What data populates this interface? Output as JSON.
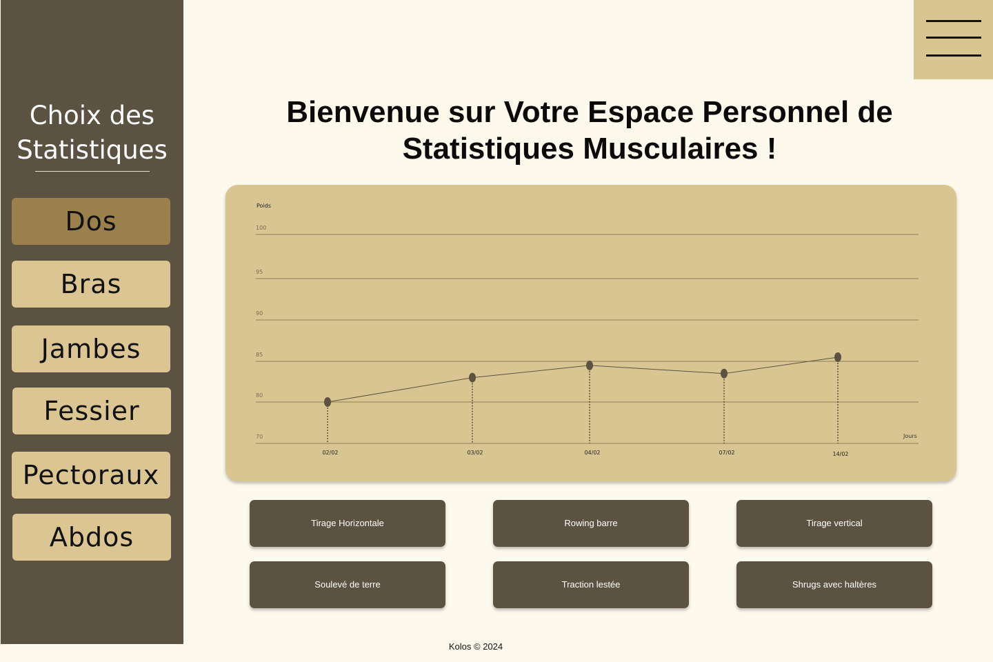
{
  "sidebar": {
    "title_line1": "Choix des",
    "title_line2": "Statistiques",
    "items": [
      {
        "label": "Dos",
        "active": true
      },
      {
        "label": "Bras",
        "active": false
      },
      {
        "label": "Jambes",
        "active": false
      },
      {
        "label": "Fessier",
        "active": false
      },
      {
        "label": "Pectoraux",
        "active": false
      },
      {
        "label": "Abdos",
        "active": false
      }
    ]
  },
  "header": {
    "menu_icon": "hamburger-menu-icon",
    "title_line1": "Bienvenue sur Votre Espace Personnel de",
    "title_line2": "Statistiques Musculaires !"
  },
  "chart_data": {
    "type": "line",
    "ylabel": "Poids",
    "xlabel": "Jours",
    "y_ticks": [
      70,
      80,
      85,
      90,
      95,
      100
    ],
    "categories": [
      "02/02",
      "03/02",
      "04/02",
      "07/02",
      "14/02"
    ],
    "values": [
      80,
      83,
      84.5,
      83.5,
      85.5
    ],
    "grid": true,
    "line_color": "#5c5242",
    "marker_color": "#5c5242"
  },
  "exercises": [
    {
      "label": "Tirage Horizontale"
    },
    {
      "label": "Rowing barre"
    },
    {
      "label": "Tirage vertical"
    },
    {
      "label": "Soulevé de terre"
    },
    {
      "label": "Traction lestée"
    },
    {
      "label": "Shrugs avec haltères"
    }
  ],
  "footer": {
    "text": "Kolos © 2024"
  },
  "colors": {
    "background": "#fdf9ec",
    "sidebar": "#5c5242",
    "accent": "#d9c592",
    "active": "#9b804e"
  }
}
